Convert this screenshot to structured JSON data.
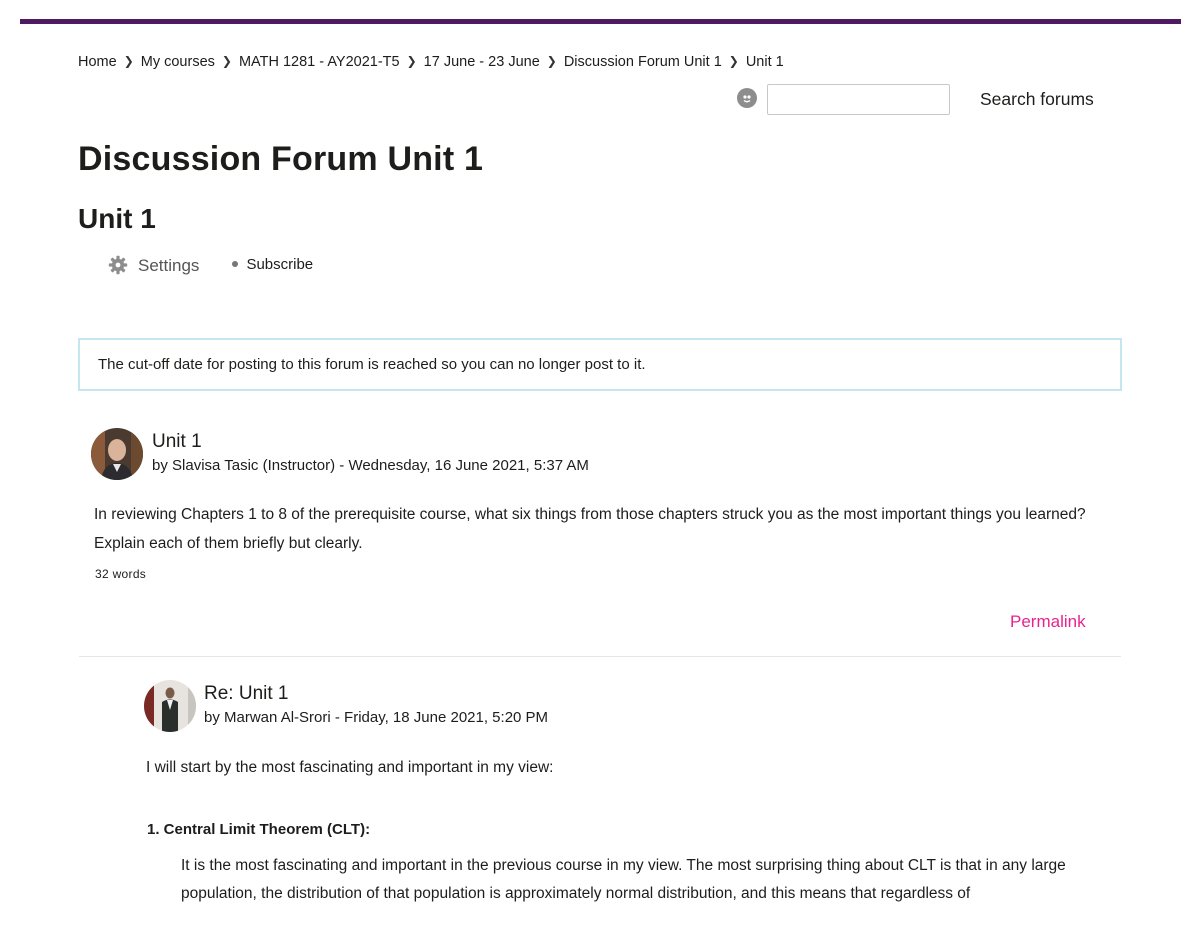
{
  "colors": {
    "brand_bar": "#4e1a62",
    "permalink": "#e8238e",
    "notice_border": "#c4e6f0"
  },
  "breadcrumb": [
    "Home",
    "My courses",
    "MATH 1281 - AY2021-T5",
    "17 June - 23 June",
    "Discussion Forum Unit 1",
    "Unit 1"
  ],
  "search": {
    "input_value": "",
    "button_label": "Search forums"
  },
  "page_title": "Discussion Forum Unit 1",
  "discussion_title": "Unit 1",
  "actions": {
    "settings_label": "Settings",
    "subscribe_label": "Subscribe"
  },
  "notice": "The cut-off date for posting to this forum is reached so you can no longer post to it.",
  "post": {
    "title": "Unit 1",
    "byline": "by Slavisa Tasic (Instructor) - Wednesday, 16 June 2021, 5:37 AM",
    "body": "In reviewing Chapters 1 to 8 of the prerequisite course, what six things from those chapters struck you as the most important things you learned? Explain each of them briefly but clearly.",
    "word_count": "32 words",
    "permalink_label": "Permalink"
  },
  "reply": {
    "title": "Re: Unit 1",
    "byline": "by Marwan Al-Srori - Friday, 18 June 2021, 5:20 PM",
    "intro": "I will start by the most fascinating and important in my view:",
    "heading": "1. Central Limit Theorem (CLT):",
    "paragraph": "It is the most fascinating and important in the previous course in my view. The most surprising thing about CLT is that in any large population, the distribution of that population is approximately normal distribution, and this means that regardless of"
  }
}
